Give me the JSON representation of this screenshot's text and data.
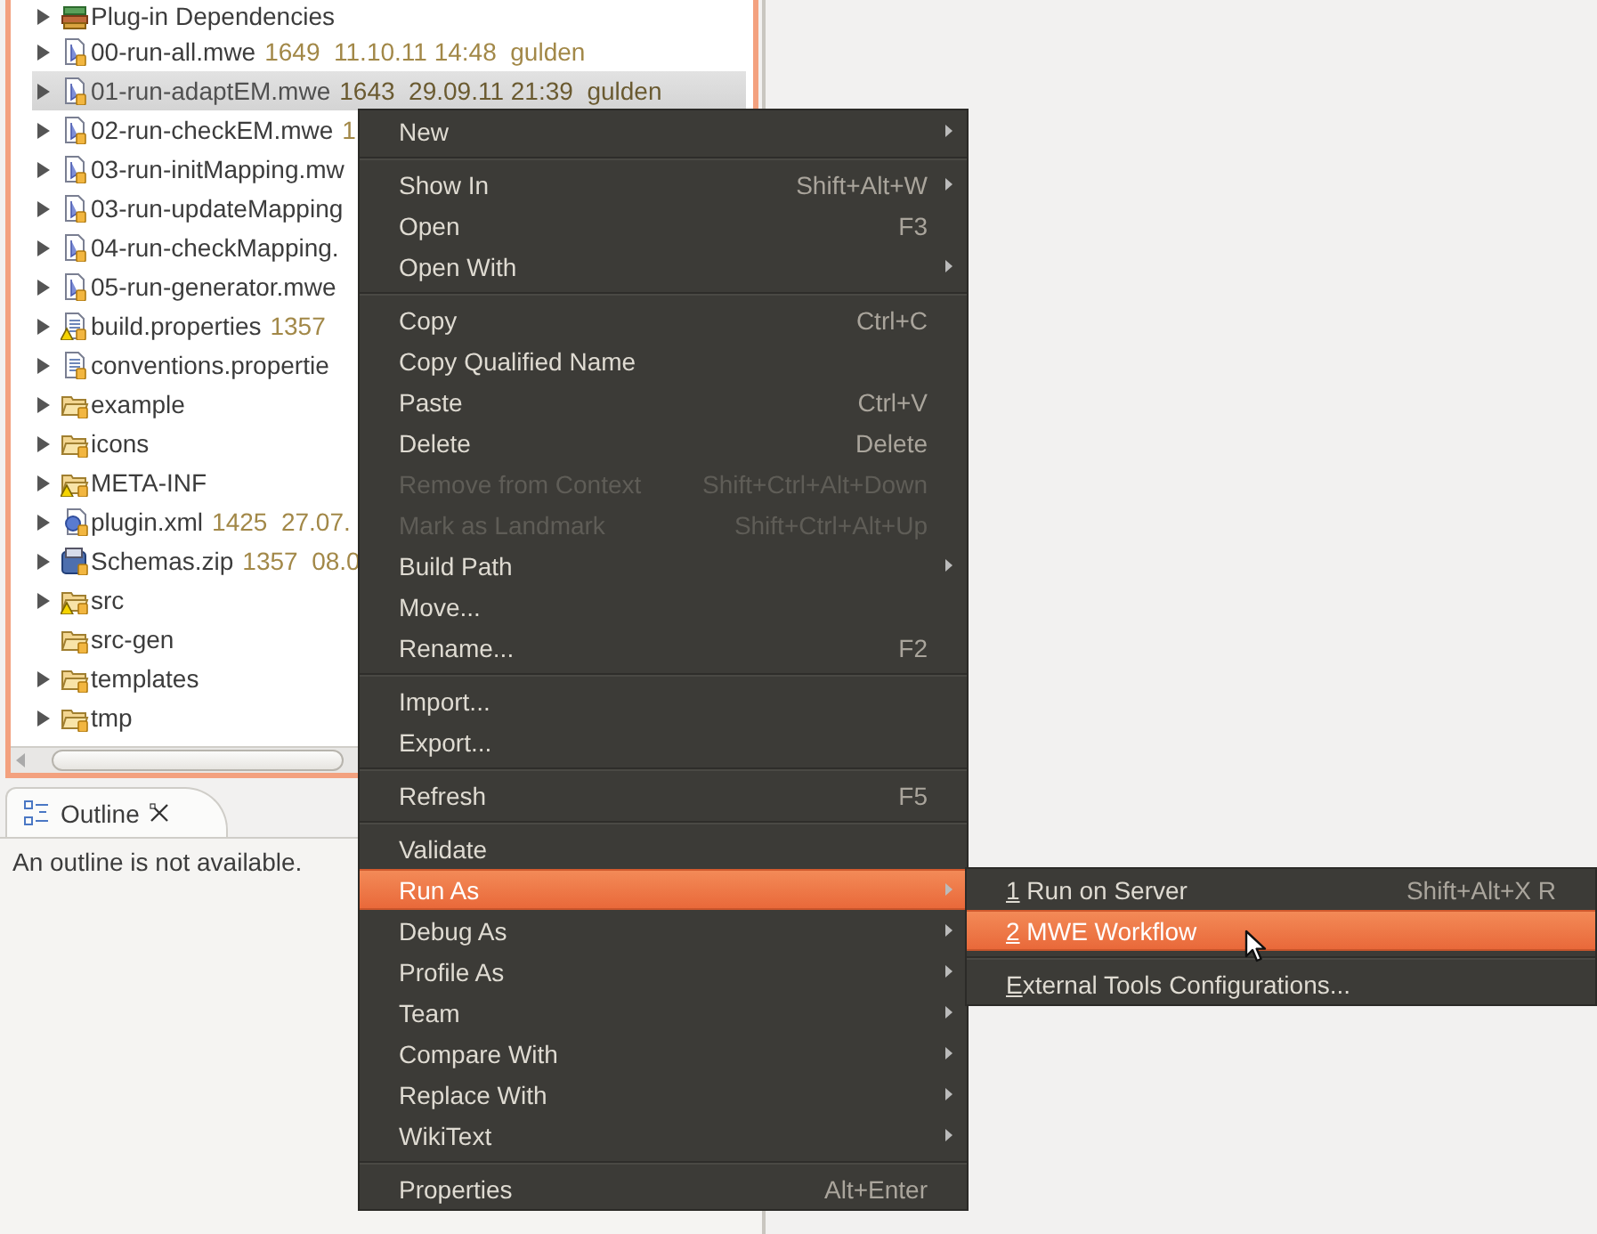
{
  "tree": {
    "items": [
      {
        "name": "Plug-in Dependencies",
        "kind": "library",
        "expandable": true,
        "warning": false,
        "selected": false
      },
      {
        "name": "00-run-all.mwe",
        "meta": "1649  11.10.11 14:48  gulden",
        "kind": "mwe",
        "expandable": true,
        "warning": false,
        "selected": false
      },
      {
        "name": "01-run-adaptEM.mwe",
        "meta": "1643  29.09.11 21:39  gulden",
        "kind": "mwe",
        "expandable": true,
        "warning": false,
        "selected": true
      },
      {
        "name": "02-run-checkEM.mwe",
        "meta": "1",
        "kind": "mwe",
        "expandable": true,
        "warning": false,
        "selected": false
      },
      {
        "name": "03-run-initMapping.mw",
        "kind": "mwe",
        "expandable": true,
        "warning": false,
        "selected": false
      },
      {
        "name": "03-run-updateMapping",
        "kind": "mwe",
        "expandable": true,
        "warning": false,
        "selected": false
      },
      {
        "name": "04-run-checkMapping.",
        "kind": "mwe",
        "expandable": true,
        "warning": false,
        "selected": false
      },
      {
        "name": "05-run-generator.mwe",
        "kind": "mwe",
        "expandable": true,
        "warning": false,
        "selected": false
      },
      {
        "name": "build.properties",
        "meta": "1357",
        "kind": "properties",
        "expandable": true,
        "warning": true,
        "selected": false
      },
      {
        "name": "conventions.propertie",
        "kind": "properties",
        "expandable": true,
        "warning": false,
        "selected": false
      },
      {
        "name": "example",
        "kind": "folder",
        "expandable": true,
        "warning": false,
        "selected": false
      },
      {
        "name": "icons",
        "kind": "folder",
        "expandable": true,
        "warning": false,
        "selected": false
      },
      {
        "name": "META-INF",
        "kind": "folder",
        "expandable": true,
        "warning": true,
        "selected": false
      },
      {
        "name": "plugin.xml",
        "meta": "1425  27.07.",
        "kind": "xml",
        "expandable": true,
        "warning": false,
        "selected": false
      },
      {
        "name": "Schemas.zip",
        "meta": "1357  08.0",
        "kind": "zip",
        "expandable": true,
        "warning": false,
        "selected": false
      },
      {
        "name": "src",
        "kind": "folder",
        "expandable": true,
        "warning": true,
        "selected": false
      },
      {
        "name": "src-gen",
        "kind": "folder",
        "expandable": false,
        "warning": false,
        "selected": false
      },
      {
        "name": "templates",
        "kind": "folder",
        "expandable": true,
        "warning": false,
        "selected": false
      },
      {
        "name": "tmp",
        "kind": "folder",
        "expandable": true,
        "warning": false,
        "selected": false
      }
    ]
  },
  "outline": {
    "tab": "Outline",
    "message": "An outline is not available."
  },
  "context_menu": {
    "items": [
      {
        "kind": "item",
        "label": "New",
        "has_submenu": true,
        "disabled": false,
        "selected": false
      },
      {
        "kind": "separator"
      },
      {
        "kind": "item",
        "label": "Show In",
        "shortcut": "Shift+Alt+W",
        "has_submenu": true,
        "disabled": false,
        "selected": false
      },
      {
        "kind": "item",
        "label": "Open",
        "shortcut": "F3",
        "has_submenu": false,
        "disabled": false,
        "selected": false
      },
      {
        "kind": "item",
        "label": "Open With",
        "has_submenu": true,
        "disabled": false,
        "selected": false
      },
      {
        "kind": "separator"
      },
      {
        "kind": "item",
        "label": "Copy",
        "shortcut": "Ctrl+C",
        "has_submenu": false,
        "disabled": false,
        "selected": false
      },
      {
        "kind": "item",
        "label": "Copy Qualified Name",
        "has_submenu": false,
        "disabled": false,
        "selected": false
      },
      {
        "kind": "item",
        "label": "Paste",
        "shortcut": "Ctrl+V",
        "has_submenu": false,
        "disabled": false,
        "selected": false
      },
      {
        "kind": "item",
        "label": "Delete",
        "shortcut": "Delete",
        "has_submenu": false,
        "disabled": false,
        "selected": false
      },
      {
        "kind": "item",
        "label": "Remove from Context",
        "shortcut": "Shift+Ctrl+Alt+Down",
        "has_submenu": false,
        "disabled": true,
        "selected": false
      },
      {
        "kind": "item",
        "label": "Mark as Landmark",
        "shortcut": "Shift+Ctrl+Alt+Up",
        "has_submenu": false,
        "disabled": true,
        "selected": false
      },
      {
        "kind": "item",
        "label": "Build Path",
        "has_submenu": true,
        "disabled": false,
        "selected": false
      },
      {
        "kind": "item",
        "label": "Move...",
        "has_submenu": false,
        "disabled": false,
        "selected": false
      },
      {
        "kind": "item",
        "label": "Rename...",
        "shortcut": "F2",
        "has_submenu": false,
        "disabled": false,
        "selected": false
      },
      {
        "kind": "separator"
      },
      {
        "kind": "item",
        "label": "Import...",
        "has_submenu": false,
        "disabled": false,
        "selected": false
      },
      {
        "kind": "item",
        "label": "Export...",
        "has_submenu": false,
        "disabled": false,
        "selected": false
      },
      {
        "kind": "separator"
      },
      {
        "kind": "item",
        "label": "Refresh",
        "shortcut": "F5",
        "has_submenu": false,
        "disabled": false,
        "selected": false
      },
      {
        "kind": "separator"
      },
      {
        "kind": "item",
        "label": "Validate",
        "has_submenu": false,
        "disabled": false,
        "selected": false
      },
      {
        "kind": "item",
        "label": "Run As",
        "has_submenu": true,
        "disabled": false,
        "selected": true
      },
      {
        "kind": "item",
        "label": "Debug As",
        "has_submenu": true,
        "disabled": false,
        "selected": false
      },
      {
        "kind": "item",
        "label": "Profile As",
        "has_submenu": true,
        "disabled": false,
        "selected": false
      },
      {
        "kind": "item",
        "label": "Team",
        "has_submenu": true,
        "disabled": false,
        "selected": false
      },
      {
        "kind": "item",
        "label": "Compare With",
        "has_submenu": true,
        "disabled": false,
        "selected": false
      },
      {
        "kind": "item",
        "label": "Replace With",
        "has_submenu": true,
        "disabled": false,
        "selected": false
      },
      {
        "kind": "item",
        "label": "WikiText",
        "has_submenu": true,
        "disabled": false,
        "selected": false
      },
      {
        "kind": "separator"
      },
      {
        "kind": "item",
        "label": "Properties",
        "shortcut": "Alt+Enter",
        "has_submenu": false,
        "disabled": false,
        "selected": false
      }
    ]
  },
  "run_as_submenu": {
    "items": [
      {
        "kind": "item",
        "label": "1 Run on Server",
        "shortcut": "Shift+Alt+X R",
        "underline_first": true,
        "disabled": false,
        "selected": false
      },
      {
        "kind": "item",
        "label": "2 MWE Workflow",
        "underline_first": true,
        "disabled": false,
        "selected": true
      },
      {
        "kind": "separator"
      },
      {
        "kind": "item",
        "label": "External Tools Configurations...",
        "underline_first": true,
        "disabled": false,
        "selected": false
      }
    ]
  }
}
